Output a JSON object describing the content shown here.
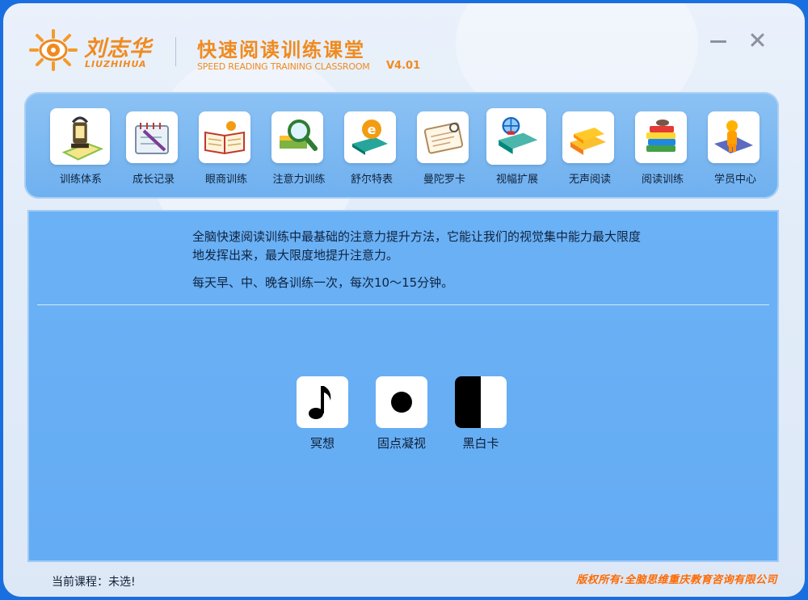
{
  "header": {
    "brand_cn": "刘志华",
    "brand_en": "LIUZHIHUA",
    "title": "快速阅读训练课堂",
    "subtitle": "SPEED READING TRAINING CLASSROOM",
    "version": "V4.01"
  },
  "window_controls": {
    "minimize": "minimize-icon",
    "close": "close-icon"
  },
  "toolbar": {
    "items": [
      {
        "label": "训练体系",
        "icon": "lamp-icon",
        "active": true
      },
      {
        "label": "成长记录",
        "icon": "notebook-pen-icon"
      },
      {
        "label": "眼商训练",
        "icon": "open-book-icon"
      },
      {
        "label": "注意力训练",
        "icon": "magnifier-icon"
      },
      {
        "label": "舒尔特表",
        "icon": "book-orange-icon"
      },
      {
        "label": "曼陀罗卡",
        "icon": "notepad-icon"
      },
      {
        "label": "视幅扩展",
        "icon": "globe-book-icon"
      },
      {
        "label": "无声阅读",
        "icon": "yellow-books-icon"
      },
      {
        "label": "阅读训练",
        "icon": "book-stack-icon"
      },
      {
        "label": "学员中心",
        "icon": "student-icon"
      }
    ]
  },
  "main": {
    "description_line1": "全脑快速阅读训练中最基础的注意力提升方法，它能让我们的视觉集中能力最大限度",
    "description_line2": "地发挥出来，最大限度地提升注意力。",
    "description_line3": "每天早、中、晚各训练一次，每次10～15分钟。",
    "courses": [
      {
        "label": "冥想",
        "icon": "music-note-icon"
      },
      {
        "label": "固点凝视",
        "icon": "dot-icon"
      },
      {
        "label": "黑白卡",
        "icon": "black-white-card-icon"
      }
    ]
  },
  "footer": {
    "status": "当前课程：未选!",
    "copyright": "版权所有:全脑思维重庆教育咨询有限公司"
  },
  "colors": {
    "accent": "#f08a1e",
    "toolbar": "#7ab7f1",
    "main": "#66aef4",
    "copyright": "#ff6a00"
  }
}
